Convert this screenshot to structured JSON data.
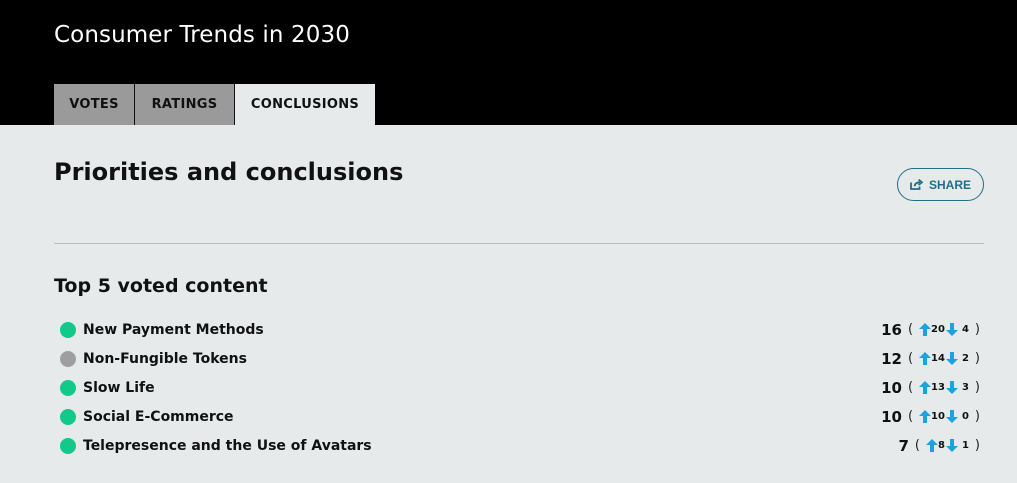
{
  "header": {
    "title": "Consumer Trends in 2030",
    "tabs": [
      {
        "label": "VOTES",
        "active": false
      },
      {
        "label": "RATINGS",
        "active": false
      },
      {
        "label": "CONCLUSIONS",
        "active": true
      }
    ]
  },
  "main": {
    "title": "Priorities and conclusions",
    "share_label": "SHARE",
    "section_title": "Top 5 voted content",
    "items": [
      {
        "label": "New Payment Methods",
        "status": "green",
        "total": "16",
        "up": "20",
        "down": "4"
      },
      {
        "label": "Non-Fungible Tokens",
        "status": "grey",
        "total": "12",
        "up": "14",
        "down": "2"
      },
      {
        "label": "Slow Life",
        "status": "green",
        "total": "10",
        "up": "13",
        "down": "3"
      },
      {
        "label": "Social E-Commerce",
        "status": "green",
        "total": "10",
        "up": "10",
        "down": "0"
      },
      {
        "label": "Telepresence and the Use of Avatars",
        "status": "green",
        "total": "7",
        "up": "8",
        "down": "1"
      }
    ],
    "paren_open": "(",
    "paren_close": ")"
  },
  "icons": {
    "share": "share-icon",
    "upvote": "arrow-up-icon",
    "downvote": "arrow-down-icon"
  },
  "colors": {
    "green": "#13c98a",
    "grey": "#9e9e9e",
    "accent": "#1f6f8b",
    "vote_arrow": "#1aa3e0"
  }
}
